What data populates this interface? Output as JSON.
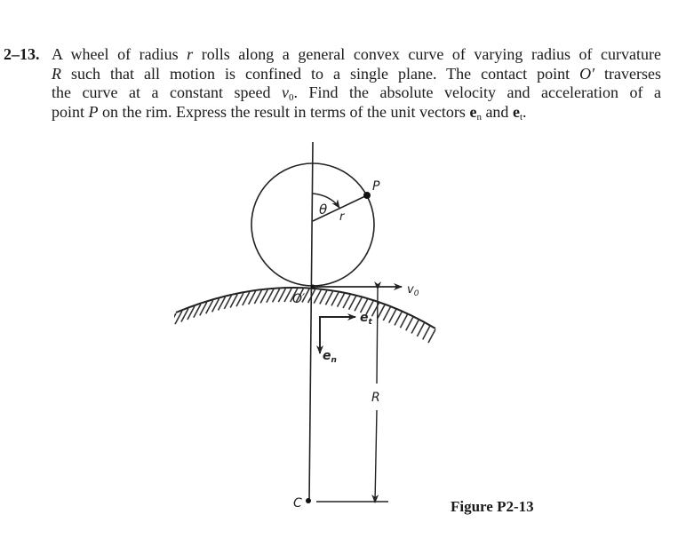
{
  "problem": {
    "number": "2–13.",
    "lines": [
      {
        "segments": [
          {
            "text": "A wheel of radius ",
            "style": "normal"
          },
          {
            "text": "r",
            "style": "italic"
          },
          {
            "text": " rolls along a general convex curve of varying radius of curvature",
            "style": "normal"
          }
        ]
      },
      {
        "segments": [
          {
            "text": "R",
            "style": "italic"
          },
          {
            "text": " such that all motion is confined to a single plane. The contact point ",
            "style": "normal"
          },
          {
            "text": "O′",
            "style": "italic"
          },
          {
            "text": " traverses",
            "style": "normal"
          }
        ]
      },
      {
        "segments": [
          {
            "text": "the curve at a constant speed ",
            "style": "normal"
          },
          {
            "text": "v",
            "style": "italic"
          },
          {
            "text": "0",
            "style": "sub"
          },
          {
            "text": ". Find the absolute velocity and acceleration of a",
            "style": "normal"
          }
        ]
      },
      {
        "segments": [
          {
            "text": "point ",
            "style": "normal"
          },
          {
            "text": "P",
            "style": "italic"
          },
          {
            "text": " on the rim. Express the result in terms of the unit vectors ",
            "style": "normal"
          },
          {
            "text": "e",
            "style": "bold"
          },
          {
            "text": "n",
            "style": "sub"
          },
          {
            "text": " and ",
            "style": "normal"
          },
          {
            "text": "e",
            "style": "bold"
          },
          {
            "text": "t",
            "style": "sub"
          },
          {
            "text": ".",
            "style": "normal"
          }
        ]
      }
    ]
  },
  "figure": {
    "labels": {
      "theta": "θ",
      "radius": "r",
      "point_p": "P",
      "contact_point": "O′",
      "velocity": "v",
      "velocity_sub": "0",
      "unit_tangent": "e",
      "unit_tangent_sub": "t",
      "unit_normal": "e",
      "unit_normal_sub": "n",
      "curvature_radius": "R",
      "center": "C"
    },
    "caption": "Figure P2-13"
  }
}
